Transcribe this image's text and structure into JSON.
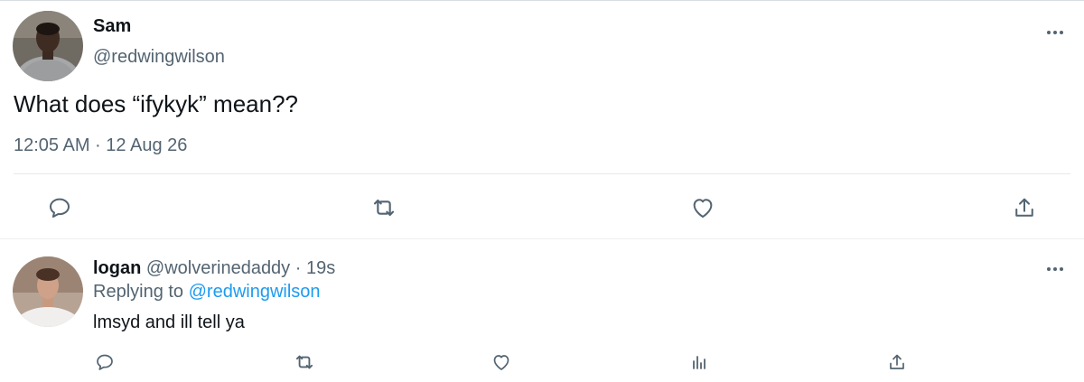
{
  "main_tweet": {
    "author_name": "Sam",
    "author_handle": "@redwingwilson",
    "text": "What does “ifykyk” mean??",
    "timestamp": "12:05 AM · 12 Aug 26",
    "avatar_icon": "user-avatar-photo",
    "actions": [
      "reply-icon",
      "retweet-icon",
      "like-icon",
      "share-icon"
    ]
  },
  "reply": {
    "author_name": "logan",
    "author_handle": "@wolverinedaddy",
    "separator": "·",
    "age": "19s",
    "replying_prefix": "Replying to",
    "replying_to": "@redwingwilson",
    "text": "lmsyd and ill tell ya",
    "avatar_icon": "user-avatar-photo",
    "actions": [
      "reply-icon",
      "retweet-icon",
      "like-icon",
      "analytics-icon",
      "share-icon"
    ]
  },
  "colors": {
    "text": "#0f1419",
    "secondary": "#536471",
    "link": "#1d9bf0",
    "divider": "#e6e9ec"
  }
}
